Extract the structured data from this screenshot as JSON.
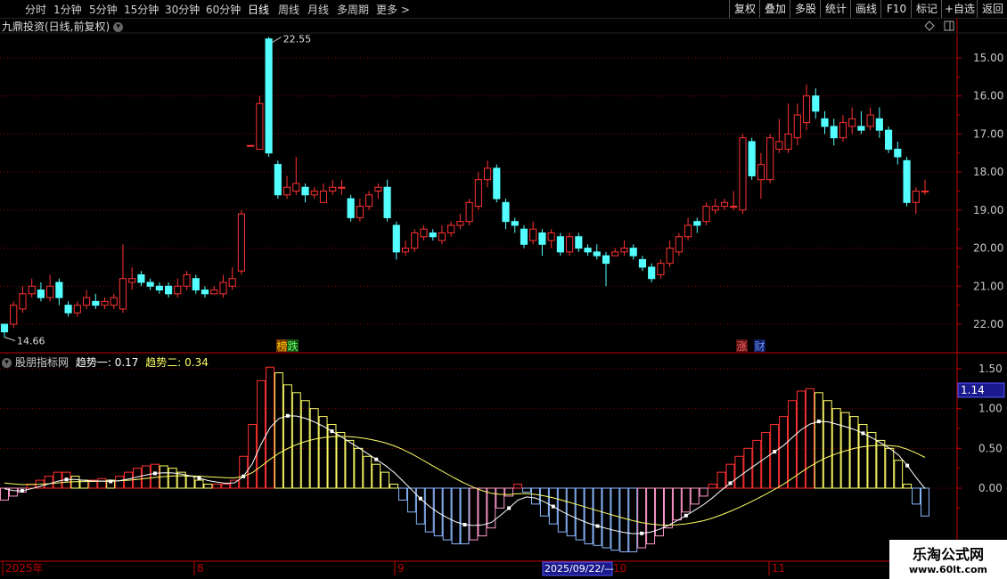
{
  "toolbar": {
    "periods": [
      "分时",
      "1分钟",
      "5分钟",
      "15分钟",
      "30分钟",
      "60分钟",
      "日线",
      "周线",
      "月线",
      "多周期",
      "更多 >"
    ],
    "active_period": "日线",
    "actions": [
      "复权",
      "叠加",
      "多股",
      "统计",
      "画线",
      "F10",
      "标记",
      "+自选",
      "返回"
    ]
  },
  "main_chart": {
    "title": "九鼎投资(日线,前复权)",
    "high_label": "22.55",
    "low_label": "14.66",
    "y_ticks": [
      "22.00",
      "21.00",
      "20.00",
      "19.00",
      "18.00",
      "17.00",
      "16.00",
      "15.00"
    ],
    "badges": [
      "榜",
      "跌",
      "涨",
      "财"
    ]
  },
  "indicator": {
    "name": "股朋指标网",
    "line1_label": "趋势一:",
    "line1_value": "0.17",
    "line2_label": "趋势二:",
    "line2_value": "0.34",
    "y_ticks": [
      "1.50",
      "1.00",
      "0.50",
      "0.00"
    ],
    "cursor_value": "1.14"
  },
  "x_axis": {
    "labels": [
      "2025年",
      "8",
      "9",
      "10",
      "11"
    ],
    "cursor_date": "2025/09/22/—"
  },
  "watermark": {
    "line1": "乐淘公式网",
    "line2": "www.60lt.com"
  },
  "colors": {
    "up": "#ff3232",
    "down": "#54ffff",
    "line1": "#ffffff",
    "line2": "#ffff66",
    "grid": "#8b0000",
    "axis": "#c00000"
  },
  "chart_data": [
    {
      "type": "candlestick",
      "title": "九鼎投资(日线,前复权)",
      "ylim": [
        14.6,
        22.6
      ],
      "y_ticks": [
        15,
        16,
        17,
        18,
        19,
        20,
        21,
        22
      ],
      "candles": [
        [
          15.0,
          14.8,
          15.0,
          14.66
        ],
        [
          15.0,
          15.5,
          15.6,
          14.9
        ],
        [
          15.4,
          15.8,
          16.0,
          15.3
        ],
        [
          15.8,
          16.0,
          16.2,
          15.7
        ],
        [
          15.9,
          15.7,
          16.1,
          15.6
        ],
        [
          15.7,
          16.0,
          16.3,
          15.6
        ],
        [
          16.1,
          15.7,
          16.2,
          15.5
        ],
        [
          15.5,
          15.3,
          15.6,
          15.2
        ],
        [
          15.3,
          15.5,
          15.6,
          15.2
        ],
        [
          15.5,
          15.7,
          15.9,
          15.4
        ],
        [
          15.6,
          15.5,
          15.8,
          15.4
        ],
        [
          15.5,
          15.6,
          15.7,
          15.4
        ],
        [
          15.5,
          15.7,
          15.8,
          15.4
        ],
        [
          15.4,
          16.2,
          17.1,
          15.3
        ],
        [
          16.1,
          16.2,
          16.5,
          15.9
        ],
        [
          16.3,
          16.1,
          16.4,
          16.0
        ],
        [
          16.1,
          16.0,
          16.2,
          15.9
        ],
        [
          16.0,
          15.9,
          16.1,
          15.8
        ],
        [
          16.0,
          15.8,
          16.1,
          15.7
        ],
        [
          15.8,
          16.0,
          16.2,
          15.7
        ],
        [
          16.0,
          16.3,
          16.4,
          15.9
        ],
        [
          16.2,
          15.9,
          16.3,
          15.8
        ],
        [
          15.9,
          15.8,
          16.0,
          15.7
        ],
        [
          15.8,
          15.9,
          16.0,
          15.8
        ],
        [
          15.8,
          16.1,
          16.3,
          15.7
        ],
        [
          16.0,
          16.2,
          16.5,
          15.9
        ],
        [
          16.4,
          17.9,
          18.0,
          16.3
        ],
        [
          19.7,
          19.7,
          19.7,
          19.7
        ],
        [
          19.6,
          20.8,
          21.0,
          19.6
        ],
        [
          22.5,
          19.5,
          22.55,
          19.4
        ],
        [
          19.2,
          18.4,
          19.3,
          18.3
        ],
        [
          18.4,
          18.6,
          18.9,
          18.3
        ],
        [
          18.5,
          18.7,
          19.4,
          18.4
        ],
        [
          18.6,
          18.4,
          18.7,
          18.2
        ],
        [
          18.4,
          18.5,
          18.6,
          18.3
        ],
        [
          18.2,
          18.5,
          18.7,
          18.2
        ],
        [
          18.5,
          18.6,
          18.8,
          18.4
        ],
        [
          18.6,
          18.6,
          18.8,
          18.4
        ],
        [
          18.3,
          17.8,
          18.4,
          17.7
        ],
        [
          17.8,
          18.1,
          18.3,
          17.7
        ],
        [
          18.1,
          18.4,
          18.5,
          18.0
        ],
        [
          18.5,
          18.6,
          18.7,
          18.3
        ],
        [
          18.6,
          17.8,
          18.8,
          17.7
        ],
        [
          17.6,
          16.9,
          17.7,
          16.7
        ],
        [
          16.9,
          17.0,
          17.2,
          16.8
        ],
        [
          17.0,
          17.4,
          17.5,
          16.9
        ],
        [
          17.3,
          17.5,
          17.6,
          17.2
        ],
        [
          17.4,
          17.3,
          17.5,
          17.2
        ],
        [
          17.2,
          17.4,
          17.6,
          17.1
        ],
        [
          17.4,
          17.6,
          17.7,
          17.3
        ],
        [
          17.6,
          17.7,
          17.9,
          17.5
        ],
        [
          17.7,
          18.2,
          18.3,
          17.6
        ],
        [
          18.1,
          18.8,
          19.0,
          18.0
        ],
        [
          18.8,
          19.1,
          19.3,
          18.6
        ],
        [
          19.1,
          18.3,
          19.2,
          18.2
        ],
        [
          18.2,
          17.7,
          18.3,
          17.5
        ],
        [
          17.7,
          17.6,
          17.8,
          17.4
        ],
        [
          17.5,
          17.1,
          17.6,
          17.0
        ],
        [
          17.2,
          17.5,
          17.7,
          17.1
        ],
        [
          17.4,
          17.1,
          17.5,
          16.8
        ],
        [
          17.2,
          17.4,
          17.5,
          17.0
        ],
        [
          17.3,
          16.9,
          17.4,
          16.8
        ],
        [
          16.9,
          17.3,
          17.4,
          16.8
        ],
        [
          17.3,
          17.0,
          17.4,
          16.9
        ],
        [
          17.0,
          16.9,
          17.1,
          16.8
        ],
        [
          16.9,
          16.8,
          17.1,
          16.7
        ],
        [
          16.8,
          16.6,
          16.9,
          16.0
        ],
        [
          16.8,
          16.9,
          17.0,
          16.8
        ],
        [
          16.9,
          17.0,
          17.2,
          16.8
        ],
        [
          17.0,
          16.8,
          17.1,
          16.7
        ],
        [
          16.7,
          16.5,
          16.8,
          16.4
        ],
        [
          16.5,
          16.2,
          16.6,
          16.1
        ],
        [
          16.3,
          16.6,
          16.7,
          16.2
        ],
        [
          16.6,
          17.0,
          17.2,
          16.5
        ],
        [
          16.9,
          17.3,
          17.4,
          16.8
        ],
        [
          17.3,
          17.6,
          17.8,
          17.2
        ],
        [
          17.7,
          17.6,
          17.8,
          17.4
        ],
        [
          17.7,
          18.1,
          18.2,
          17.6
        ],
        [
          18.0,
          18.1,
          18.3,
          17.9
        ],
        [
          18.1,
          18.2,
          18.3,
          18.0
        ],
        [
          18.1,
          18.1,
          18.5,
          18.0
        ],
        [
          18.0,
          19.9,
          20.0,
          17.9
        ],
        [
          19.8,
          18.9,
          19.9,
          18.8
        ],
        [
          18.8,
          19.2,
          19.5,
          18.3
        ],
        [
          18.8,
          19.9,
          20.0,
          18.7
        ],
        [
          19.6,
          19.8,
          20.4,
          19.5
        ],
        [
          19.6,
          20.0,
          20.8,
          19.5
        ],
        [
          19.9,
          20.5,
          20.8,
          19.7
        ],
        [
          20.3,
          21.0,
          21.3,
          20.1
        ],
        [
          21.0,
          20.6,
          21.2,
          20.4
        ],
        [
          20.4,
          20.2,
          20.6,
          20.0
        ],
        [
          20.2,
          19.9,
          20.4,
          19.7
        ],
        [
          19.9,
          20.3,
          20.5,
          19.8
        ],
        [
          20.2,
          20.4,
          20.7,
          20.0
        ],
        [
          20.2,
          20.1,
          20.6,
          20.0
        ],
        [
          20.2,
          20.5,
          20.7,
          20.1
        ],
        [
          20.4,
          20.1,
          20.7,
          19.9
        ],
        [
          20.1,
          19.6,
          20.2,
          19.5
        ],
        [
          19.6,
          19.4,
          19.8,
          19.2
        ],
        [
          19.3,
          18.2,
          19.4,
          18.1
        ],
        [
          18.2,
          18.5,
          18.6,
          17.9
        ],
        [
          18.5,
          18.5,
          18.8,
          18.4
        ]
      ]
    },
    {
      "type": "bar+line",
      "title": "股朋指标网",
      "ylim": [
        -0.8,
        1.7
      ],
      "y_ticks": [
        0,
        0.5,
        1.0,
        1.5
      ],
      "series": [
        {
          "name": "趋势一",
          "last_value": 0.17
        },
        {
          "name": "趋势二",
          "last_value": 0.34
        }
      ],
      "histogram": [
        -0.15,
        -0.1,
        -0.05,
        0.05,
        0.1,
        0.15,
        0.2,
        0.2,
        0.15,
        0.1,
        0.1,
        0.12,
        0.1,
        0.15,
        0.2,
        0.25,
        0.28,
        0.3,
        0.28,
        0.25,
        0.2,
        0.15,
        0.1,
        0.05,
        0.05,
        0.05,
        0.1,
        0.4,
        0.8,
        1.35,
        1.52,
        1.45,
        1.3,
        1.2,
        1.1,
        1.0,
        0.9,
        0.8,
        0.7,
        0.6,
        0.5,
        0.4,
        0.3,
        0.2,
        0.05,
        -0.15,
        -0.3,
        -0.45,
        -0.55,
        -0.6,
        -0.65,
        -0.7,
        -0.7,
        -0.65,
        -0.6,
        -0.5,
        -0.25,
        -0.1,
        0.05,
        -0.05,
        -0.2,
        -0.35,
        -0.45,
        -0.55,
        -0.6,
        -0.65,
        -0.7,
        -0.72,
        -0.75,
        -0.78,
        -0.8,
        -0.8,
        -0.75,
        -0.7,
        -0.6,
        -0.5,
        -0.4,
        -0.3,
        -0.2,
        -0.1,
        0.05,
        0.2,
        0.3,
        0.4,
        0.5,
        0.6,
        0.7,
        0.8,
        0.9,
        1.1,
        1.22,
        1.25,
        1.2,
        1.1,
        1.0,
        0.95,
        0.9,
        0.8,
        0.7,
        0.6,
        0.5,
        0.35,
        0.05,
        -0.2,
        -0.35
      ]
    }
  ]
}
